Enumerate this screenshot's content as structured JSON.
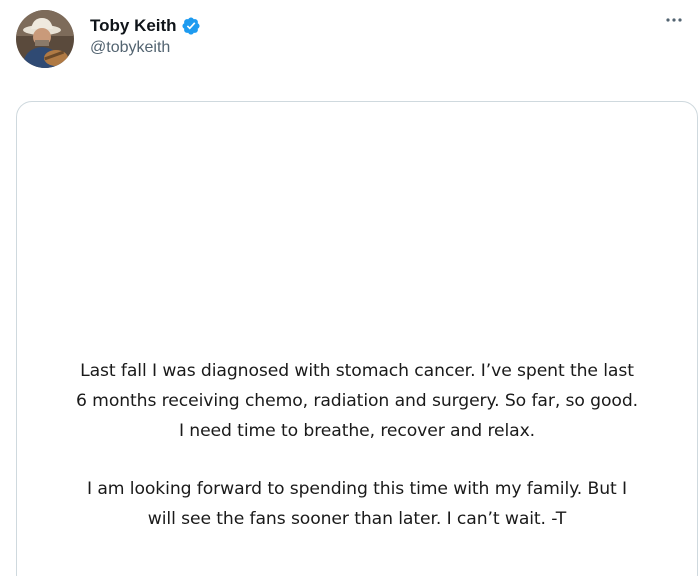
{
  "tweet": {
    "author": {
      "display_name": "Toby Keith",
      "handle": "@tobykeith",
      "verified_icon": "verified-badge-icon",
      "avatar": "profile-photo"
    },
    "more_icon": "more-options-icon",
    "media": {
      "paragraphs": [
        {
          "lines": [
            "Last fall I was diagnosed with stomach cancer. I’ve spent the last",
            "6 months receiving chemo, radiation and surgery. So far, so good.",
            "I need time to breathe, recover and relax."
          ]
        },
        {
          "lines": [
            "I am looking forward to spending this time with my family. But I",
            "will see the fans sooner than later. I can’t wait. -T"
          ]
        }
      ]
    }
  },
  "colors": {
    "text_primary": "#0f1419",
    "text_secondary": "#536471",
    "verified_blue": "#1d9bf0",
    "border": "#cfd9de"
  }
}
